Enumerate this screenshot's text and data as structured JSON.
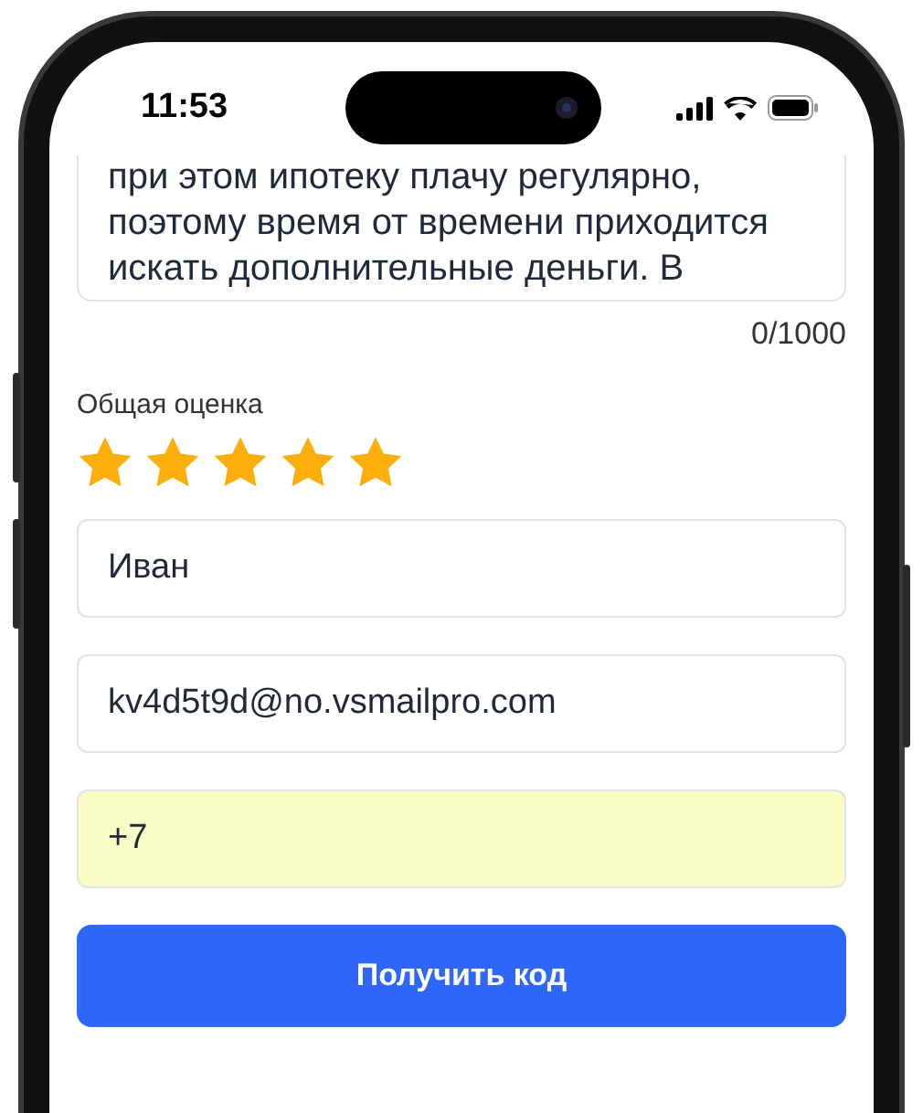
{
  "status_bar": {
    "time": "11:53"
  },
  "review": {
    "text": "при этом ипотеку плачу регулярно, поэтому время от времени приходится искать дополнительные деньги. В",
    "counter": "0/1000"
  },
  "rating": {
    "label": "Общая оценка",
    "stars": 5
  },
  "fields": [
    {
      "value": "Иван",
      "autofilled": false
    },
    {
      "value": "kv4d5t9d@no.vsmailpro.com",
      "autofilled": false
    },
    {
      "value": "+7",
      "autofilled": true
    }
  ],
  "submit": {
    "label": "Получить код"
  }
}
